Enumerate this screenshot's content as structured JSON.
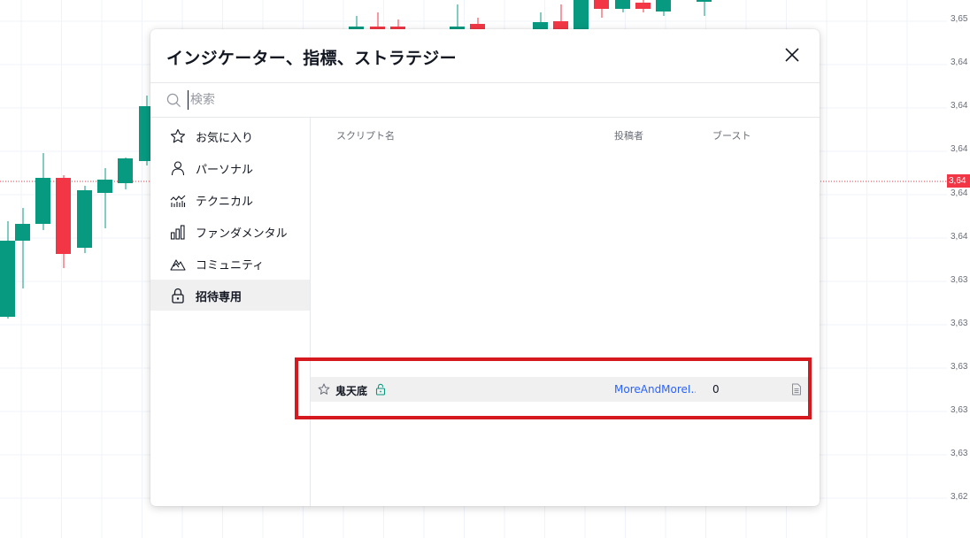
{
  "dialog": {
    "title": "インジケーター、指標、ストラテジー",
    "close_icon": "close-icon"
  },
  "search": {
    "placeholder": "検索",
    "value": "",
    "icon": "search-icon"
  },
  "sidebar": {
    "items": [
      {
        "label": "お気に入り",
        "icon": "star-icon",
        "active": false
      },
      {
        "label": "パーソナル",
        "icon": "user-icon",
        "active": false
      },
      {
        "label": "テクニカル",
        "icon": "technical-chart-icon",
        "active": false
      },
      {
        "label": "ファンダメンタル",
        "icon": "bar-chart-icon",
        "active": false
      },
      {
        "label": "コミュニティ",
        "icon": "community-mountain-icon",
        "active": false
      },
      {
        "label": "招待専用",
        "icon": "lock-icon",
        "active": true
      }
    ]
  },
  "table": {
    "headers": {
      "name": "スクリプト名",
      "author": "投稿者",
      "boosts": "ブースト"
    },
    "rows": [
      {
        "name": "鬼天底",
        "author": "MoreAndMoreI...",
        "boosts": "0",
        "locked": true,
        "favorite": false
      }
    ]
  },
  "price_axis": {
    "labels": [
      "3,65",
      "3,64",
      "3,64",
      "3,64",
      "3,64",
      "3,64",
      "3,63",
      "3,63",
      "3,63",
      "3,63",
      "3,63",
      "3,62"
    ],
    "current": "3,64"
  },
  "colors": {
    "up_candle": "#089981",
    "down_candle": "#f23645",
    "highlight": "#d6191e",
    "link": "#2962ff",
    "active_item_bg": "#f0f0f0"
  }
}
